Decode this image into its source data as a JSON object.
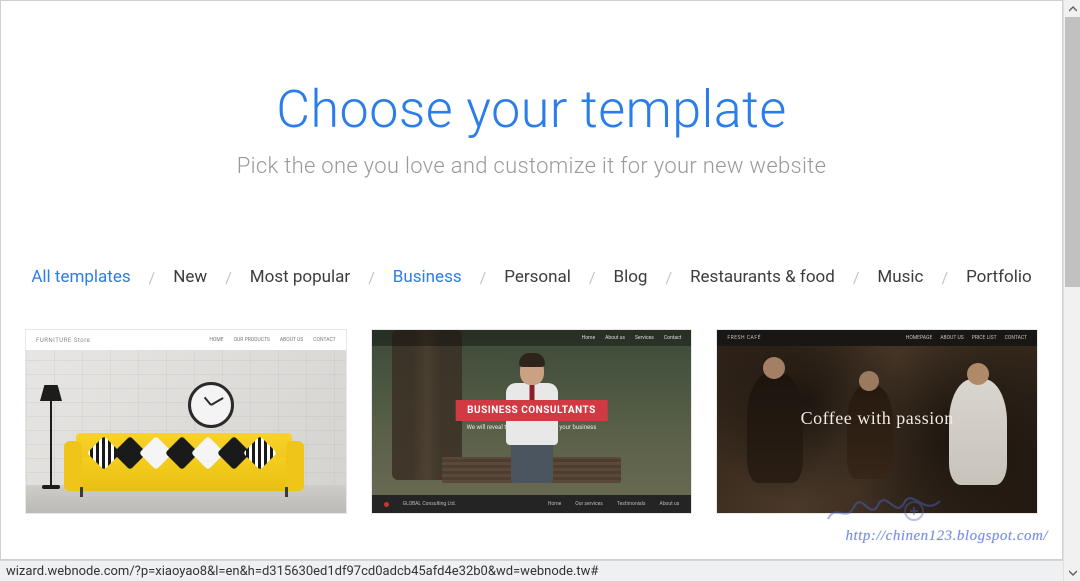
{
  "hero": {
    "title": "Choose your template",
    "subtitle": "Pick the one you love and customize it for your new website"
  },
  "categories": {
    "items": [
      {
        "label": "All templates",
        "active": false,
        "highlight": true
      },
      {
        "label": "New",
        "active": false
      },
      {
        "label": "Most popular",
        "active": false
      },
      {
        "label": "Business",
        "active": true
      },
      {
        "label": "Personal",
        "active": false
      },
      {
        "label": "Blog",
        "active": false
      },
      {
        "label": "Restaurants & food",
        "active": false
      },
      {
        "label": "Music",
        "active": false
      },
      {
        "label": "Portfolio",
        "active": false
      }
    ],
    "separator": "/"
  },
  "templates": [
    {
      "brand": "FURNITURE",
      "brand_suffix": "Store",
      "nav": [
        "HOME",
        "OUR PRODUCTS",
        "ABOUT US",
        "CONTACT"
      ]
    },
    {
      "nav": [
        "Home",
        "About us",
        "Services",
        "Contact"
      ],
      "banner": "BUSINESS CONSULTANTS",
      "subline": "We will reveal the best strategy for your business",
      "footer_brand": "GLOBAL Consulting Ltd.",
      "footer_nav": [
        "Home",
        "Our services",
        "Testimonials",
        "About us"
      ]
    },
    {
      "brand": "FRESH CAFÉ",
      "nav": [
        "HOMEPAGE",
        "ABOUT US",
        "PRICE LIST",
        "CONTACT"
      ],
      "headline": "Coffee with passion"
    }
  ],
  "statusbar": {
    "url": "wizard.webnode.com/?p=xiaoyao8&l=en&h=d315630ed1df97cd0adcb45afd4e32b0&wd=webnode.tw#"
  },
  "watermark": {
    "text": "http://chinen123.blogspot.com/"
  }
}
